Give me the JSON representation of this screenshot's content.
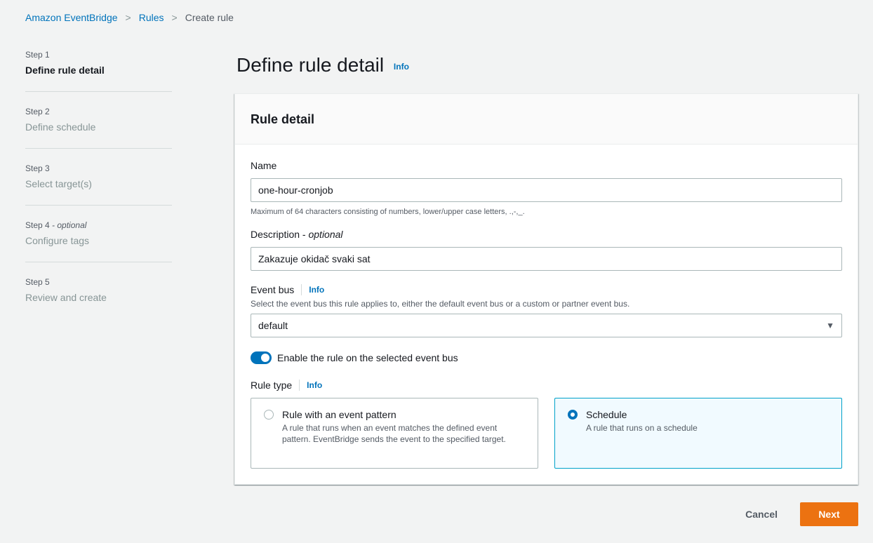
{
  "breadcrumb": {
    "items": [
      "Amazon EventBridge",
      "Rules",
      "Create rule"
    ],
    "separator": ">"
  },
  "steps": [
    {
      "number": "Step 1",
      "optional": "",
      "title": "Define rule detail",
      "active": true
    },
    {
      "number": "Step 2",
      "optional": "",
      "title": "Define schedule",
      "active": false
    },
    {
      "number": "Step 3",
      "optional": "",
      "title": "Select target(s)",
      "active": false
    },
    {
      "number": "Step 4",
      "optional": " - optional",
      "title": "Configure tags",
      "active": false
    },
    {
      "number": "Step 5",
      "optional": "",
      "title": "Review and create",
      "active": false
    }
  ],
  "page": {
    "title": "Define rule detail",
    "info": "Info"
  },
  "panel": {
    "title": "Rule detail",
    "name": {
      "label": "Name",
      "value": "one-hour-cronjob",
      "hint": "Maximum of 64 characters consisting of numbers, lower/upper case letters, .,-,_."
    },
    "description": {
      "label": "Description - ",
      "label_optional": "optional",
      "value": "Zakazuje okidač svaki sat"
    },
    "event_bus": {
      "label": "Event bus",
      "info": "Info",
      "description": "Select the event bus this rule applies to, either the default event bus or a custom or partner event bus.",
      "selected": "default",
      "caret_icon": "caret-down-icon"
    },
    "enable_toggle": {
      "label": "Enable the rule on the selected event bus",
      "on": true
    },
    "rule_type": {
      "label": "Rule type",
      "info": "Info",
      "options": [
        {
          "title": "Rule with an event pattern",
          "description": "A rule that runs when an event matches the defined event pattern. EventBridge sends the event to the specified target.",
          "selected": false
        },
        {
          "title": "Schedule",
          "description": "A rule that runs on a schedule",
          "selected": true
        }
      ]
    }
  },
  "footer": {
    "cancel": "Cancel",
    "next": "Next"
  },
  "colors": {
    "link": "#0073bb",
    "primary_button": "#ec7211",
    "selected_tile_bg": "#f1faff",
    "selected_tile_border": "#00a1c9"
  }
}
